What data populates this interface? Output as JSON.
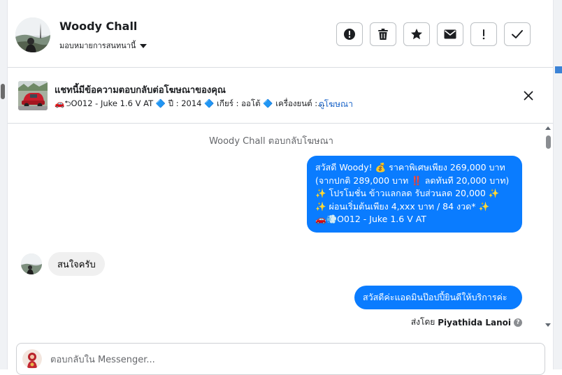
{
  "header": {
    "contact_name": "Woody Chall",
    "assign_label": "มอบหมายการสนทนานี้",
    "actions": [
      {
        "name": "alert-circle",
        "icon": "alert-circle-icon"
      },
      {
        "name": "trash",
        "icon": "trash-icon"
      },
      {
        "name": "star",
        "icon": "star-icon"
      },
      {
        "name": "mail",
        "icon": "envelope-icon"
      },
      {
        "name": "exclamation",
        "icon": "exclamation-icon"
      },
      {
        "name": "check",
        "icon": "check-icon"
      }
    ]
  },
  "ad": {
    "title": "แชทนี้มีข้อความตอบกลับต่อโฆษณาของคุณ",
    "detail": "🚗⮌O012 - Juke 1.6 V AT 🔷 ปี : 2014 🔷 เกียร์ : ออโต้ 🔷 เครื่องยนต์ :...",
    "link": "ดูโฆษณา",
    "close_icon": "close-icon"
  },
  "conversation": {
    "system_note": "Woody Chall ตอบกลับโฆษณา",
    "messages": [
      {
        "direction": "outgoing",
        "lines": [
          "สวัสดี Woody! 💰 ราคาพิเศษเพียง 269,000 บาท",
          "(จากปกติ 289,000 บาท ‼️ ลดทันที 20,000 บาท)",
          "✨ โปรโมชั่น ข้าวแลกลด รับส่วนลด 20,000 ✨",
          "✨ ผ่อนเริ่มต้นเพียง 4,xxx บาท / 84 งวด* ✨",
          "🚗💨O012 - Juke 1.6 V AT"
        ]
      },
      {
        "direction": "incoming",
        "text": "สนใจครับ"
      },
      {
        "direction": "outgoing",
        "text": "สวัสดีค่ะแอดมินป๊อปปี้ยินดีให้บริการค่ะ"
      }
    ],
    "sent_by_prefix": "ส่งโดย",
    "sent_by_name": "Piyathida Lanoi"
  },
  "composer": {
    "placeholder": "ตอบกลับใน Messenger..."
  },
  "colors": {
    "outgoing_bubble": "#0a7cff",
    "incoming_bubble": "#f0f0f0",
    "link": "#1b65c9"
  }
}
